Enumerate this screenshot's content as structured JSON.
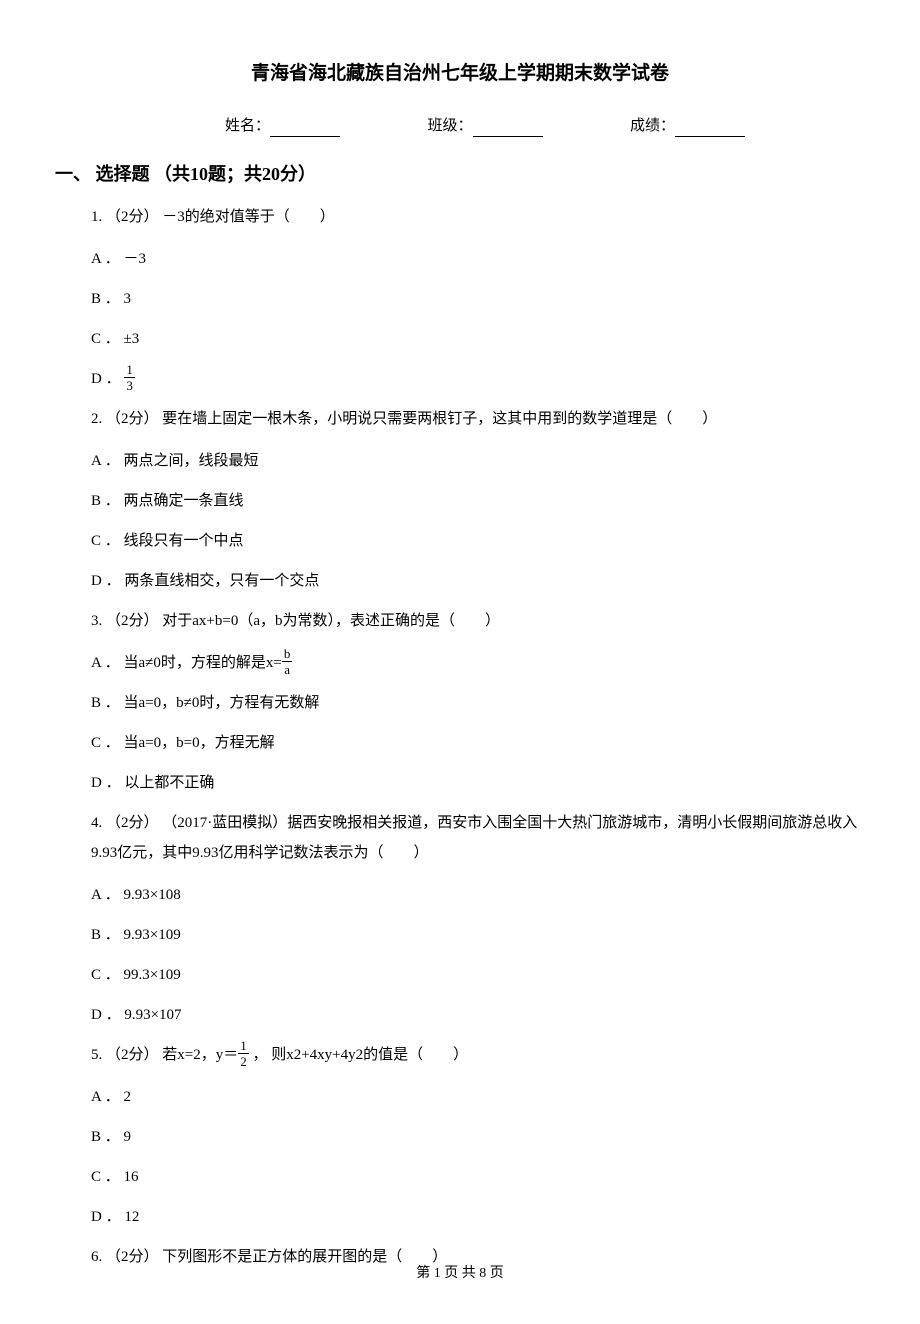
{
  "title": "青海省海北藏族自治州七年级上学期期末数学试卷",
  "fields": {
    "name_label": "姓名：",
    "class_label": "班级：",
    "score_label": "成绩："
  },
  "section1": {
    "heading": "一、 选择题 （共10题；共20分）",
    "q1": {
      "stem": "1.  （2分） －3的绝对值等于（　　）",
      "A": "A ． －3",
      "B": "B ． 3",
      "C": "C ． ±3",
      "D_prefix": "D ．",
      "D_num": "1",
      "D_den": "3"
    },
    "q2": {
      "stem": "2.  （2分）  要在墙上固定一根木条，小明说只需要两根钉子，这其中用到的数学道理是（　　）",
      "A": "A ． 两点之间，线段最短",
      "B": "B ． 两点确定一条直线",
      "C": "C ． 线段只有一个中点",
      "D": "D ． 两条直线相交，只有一个交点"
    },
    "q3": {
      "stem": "3.  （2分）  对于ax+b=0（a，b为常数），表述正确的是（　　）",
      "A_prefix": "A ． 当a≠0时，方程的解是x=",
      "A_num": "b",
      "A_den": "a",
      "B": "B ． 当a=0，b≠0时，方程有无数解",
      "C": "C ． 当a=0，b=0，方程无解",
      "D": "D ． 以上都不正确"
    },
    "q4": {
      "stem": "4.  （2分） （2017·蓝田模拟）据西安晚报相关报道，西安市入围全国十大热门旅游城市，清明小长假期间旅游总收入9.93亿元，其中9.93亿用科学记数法表示为（　　）",
      "A": "A ． 9.93×108",
      "B": "B ． 9.93×109",
      "C": "C ． 99.3×109",
      "D": "D ． 9.93×107"
    },
    "q5": {
      "stem_prefix": "5.  （2分）  若x=2，y＝",
      "stem_num": "1",
      "stem_den": "2",
      "stem_suffix": " ，  则x2+4xy+4y2的值是（　　）",
      "A": "A ． 2",
      "B": "B ． 9",
      "C": "C ． 16",
      "D": "D ． 12"
    },
    "q6": {
      "stem": "6.  （2分）  下列图形不是正方体的展开图的是（　　）"
    }
  },
  "footer": {
    "page_prefix": "第 ",
    "page_current": "1",
    "page_mid": " 页 共 ",
    "page_total": "8",
    "page_suffix": " 页"
  }
}
